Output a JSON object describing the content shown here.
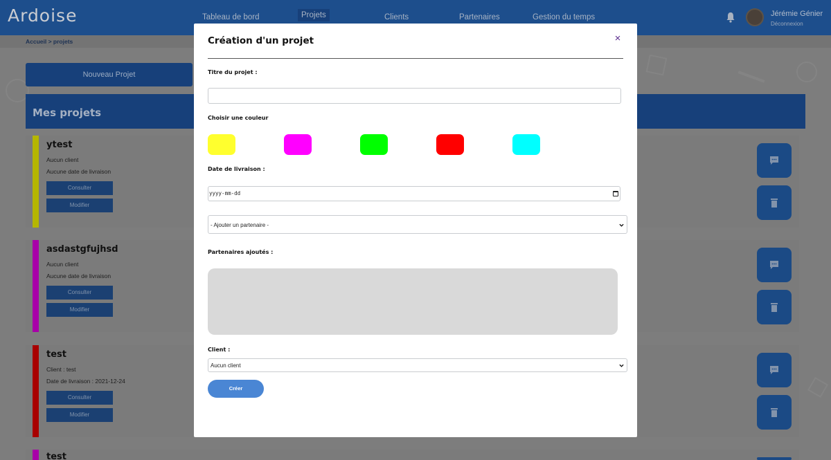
{
  "app": {
    "logo": "Ardoise"
  },
  "nav": {
    "items": [
      "Tableau de bord",
      "Projets",
      "Clients",
      "Partenaires",
      "Gestion du temps"
    ],
    "active": "Projets"
  },
  "user": {
    "name": "Jérémie Génier",
    "logout": "Déconnexion"
  },
  "breadcrumb": "Accueil > projets",
  "page": {
    "new_project_label": "Nouveau Projet",
    "section_title": "Mes projets"
  },
  "projects": [
    {
      "title": "ytest",
      "client": "Aucun client",
      "delivery": "Aucune date de livraison",
      "color": "#d2d400"
    },
    {
      "title": "asdastgfujhsd",
      "client": "Aucun client",
      "delivery": "Aucune date de livraison",
      "color": "#c800c8"
    },
    {
      "title": "test",
      "client": "Client : test",
      "delivery": "Date de livraison : 2021-12-24",
      "color": "#c80000"
    },
    {
      "title": "test",
      "client": "",
      "delivery": "",
      "color": "#c800c8"
    }
  ],
  "card_buttons": {
    "consult": "Consulter",
    "edit": "Modifier"
  },
  "modal": {
    "title": "Création d'un projet",
    "close_glyph": "×",
    "project_title_label": "Titre du projet :",
    "project_title_value": "",
    "color_label": "Choisir une couleur",
    "colors": [
      "#ffff2e",
      "#ff00ff",
      "#00ff00",
      "#ff0000",
      "#00ffff"
    ],
    "date_label": "Date de livraison :",
    "date_placeholder": "yyyy-mm-dd",
    "partner_select": "- Ajouter un partenaire -",
    "partners_added_label": "Partenaires ajoutés :",
    "client_label": "Client :",
    "client_select": "Aucun client",
    "create_label": "Créer"
  },
  "icons": {
    "bell": "bell-icon",
    "comment": "comment-icon",
    "trash": "trash-icon",
    "close": "close-icon",
    "calendar": "calendar-icon",
    "chevron": "chevron-down-icon"
  }
}
